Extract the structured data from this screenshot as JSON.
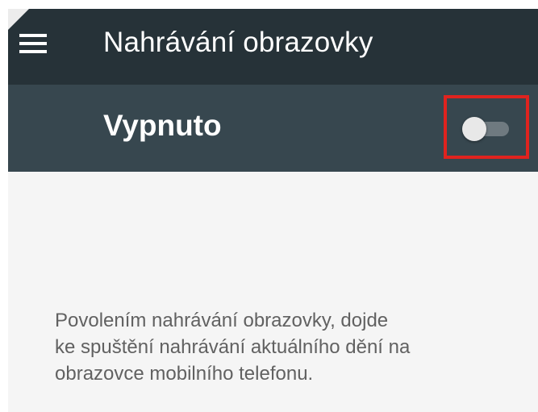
{
  "app_bar": {
    "menu_icon": "hamburger-menu-icon",
    "title": "Nahrávání obrazovky",
    "background": "#263238"
  },
  "toggle_bar": {
    "label": "Vypnuto",
    "switch_state": "off",
    "background": "#37474f",
    "highlight_color": "#e0231f"
  },
  "description": {
    "line1": "Povolením nahrávání obrazovky, dojde",
    "line2": "ke spuštění nahrávání aktuálního dění na",
    "line3": "obrazovce mobilního telefonu."
  }
}
